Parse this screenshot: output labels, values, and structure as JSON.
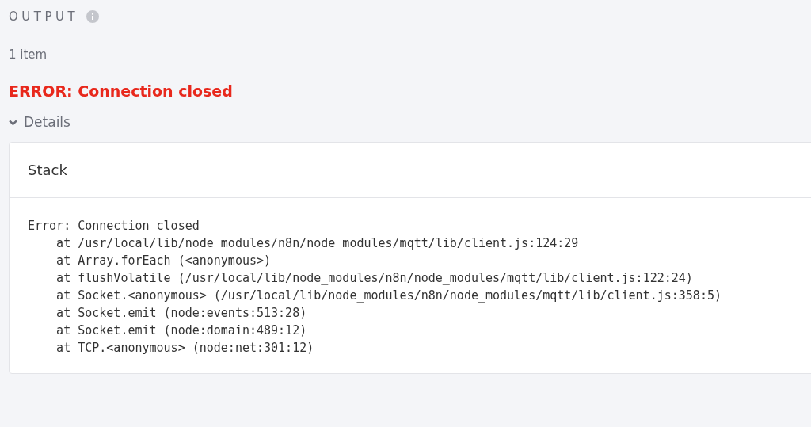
{
  "section": {
    "title": "OUTPUT",
    "item_count": "1 item"
  },
  "error": {
    "message": "ERROR: Connection closed"
  },
  "details": {
    "label": "Details",
    "expanded": true,
    "card": {
      "title": "Stack",
      "stack": "Error: Connection closed\n    at /usr/local/lib/node_modules/n8n/node_modules/mqtt/lib/client.js:124:29\n    at Array.forEach (<anonymous>)\n    at flushVolatile (/usr/local/lib/node_modules/n8n/node_modules/mqtt/lib/client.js:122:24)\n    at Socket.<anonymous> (/usr/local/lib/node_modules/n8n/node_modules/mqtt/lib/client.js:358:5)\n    at Socket.emit (node:events:513:28)\n    at Socket.emit (node:domain:489:12)\n    at TCP.<anonymous> (node:net:301:12)"
    }
  }
}
